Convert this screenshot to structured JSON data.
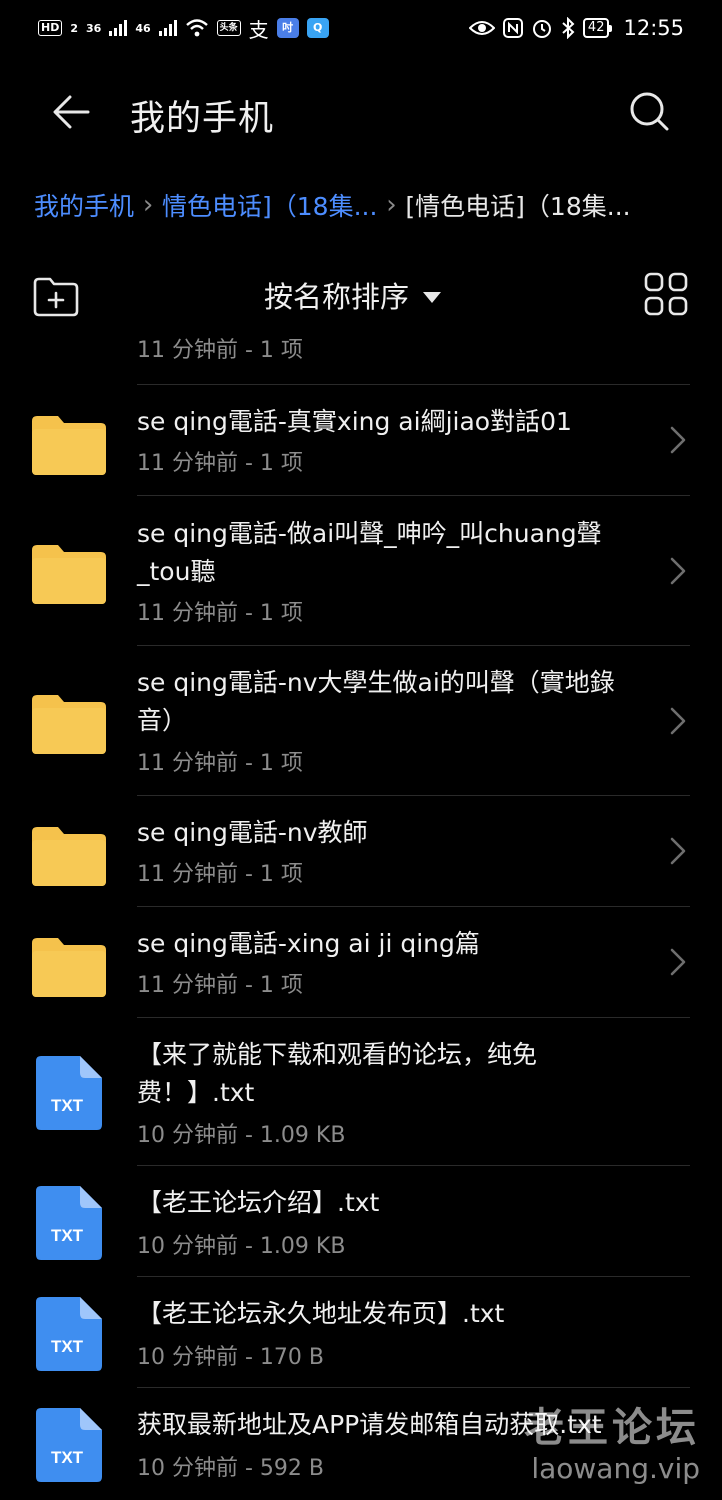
{
  "status_bar": {
    "hd_label": "HD",
    "sim_label": "2",
    "net1": "36",
    "net2": "46",
    "app_badge": "头条",
    "alipay": "支",
    "app2": "吋",
    "battery": "42",
    "time": "12:55"
  },
  "header": {
    "title": "我的手机"
  },
  "breadcrumb": {
    "items": [
      "我的手机",
      "情色电话]（18集...",
      "[情色电话]（18集..."
    ]
  },
  "toolbar": {
    "sort_label": "按名称排序"
  },
  "files": [
    {
      "type": "folder",
      "name": "",
      "meta": "11 分钟前 - 1 项"
    },
    {
      "type": "folder",
      "name": "se qing電話-真實xing ai綱jiao對話01",
      "meta": "11 分钟前 - 1 项"
    },
    {
      "type": "folder",
      "name": "se qing電話-做ai叫聲_呻吟_叫chuang聲_tou聽",
      "meta": "11 分钟前 - 1 项"
    },
    {
      "type": "folder",
      "name": "se qing電話-nv大學生做ai的叫聲（實地錄音）",
      "meta": "11 分钟前 - 1 项"
    },
    {
      "type": "folder",
      "name": "se qing電話-nv教師",
      "meta": "11 分钟前 - 1 项"
    },
    {
      "type": "folder",
      "name": "se qing電話-xing ai ji qing篇",
      "meta": "11 分钟前 - 1 项"
    },
    {
      "type": "txt",
      "name": "【来了就能下载和观看的论坛，纯免费！】.txt",
      "meta": "10 分钟前 - 1.09 KB"
    },
    {
      "type": "txt",
      "name": "【老王论坛介绍】.txt",
      "meta": "10 分钟前 - 1.09 KB"
    },
    {
      "type": "txt",
      "name": "【老王论坛永久地址发布页】.txt",
      "meta": "10 分钟前 - 170 B"
    },
    {
      "type": "txt",
      "name": "获取最新地址及APP请发邮箱自动获取.txt",
      "meta": "10 分钟前 - 592 B"
    }
  ],
  "icons": {
    "txt_label": "TXT",
    "folder_color": "#f5c24c",
    "txt_color": "#3f8ef0"
  },
  "watermark": {
    "title": "老王论坛",
    "url": "laowang.vip"
  }
}
